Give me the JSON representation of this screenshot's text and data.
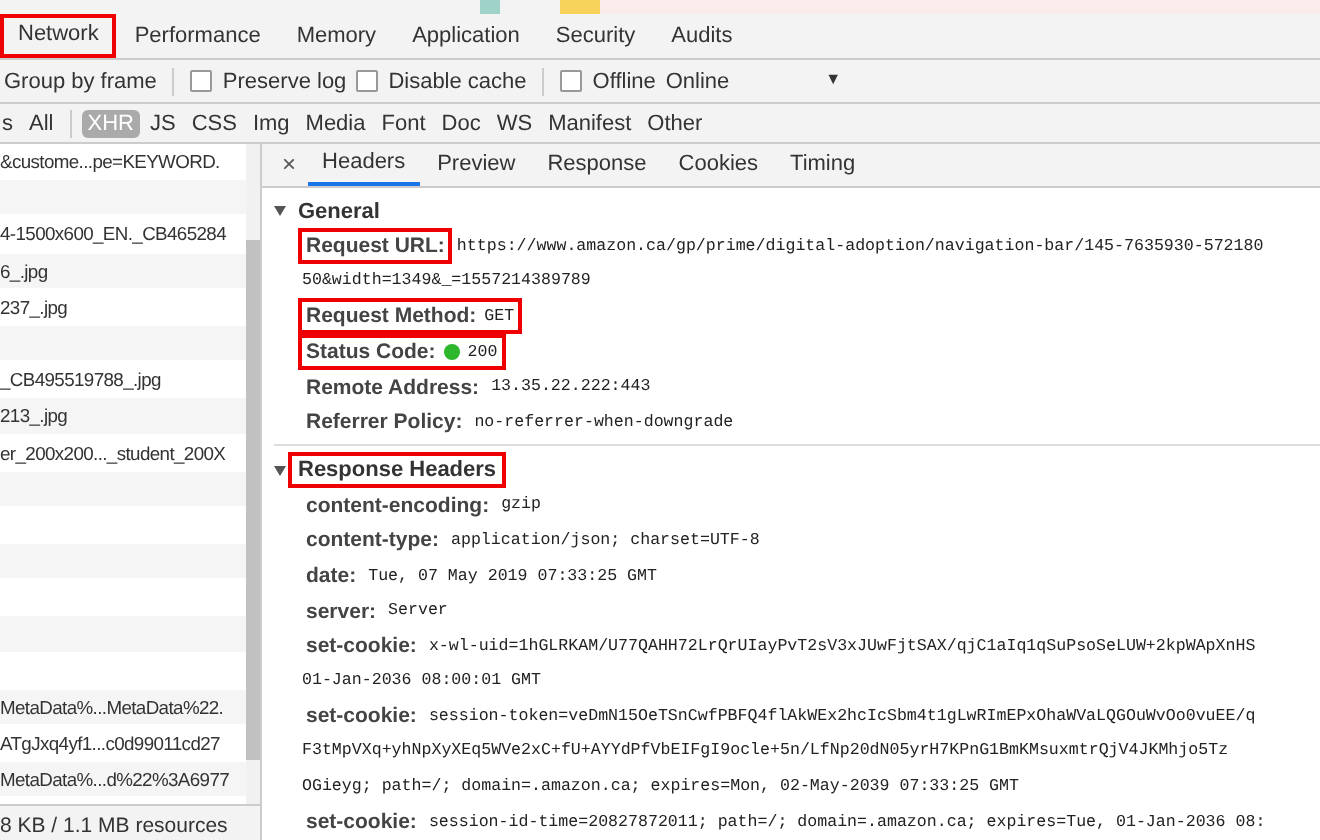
{
  "tabs": [
    {
      "label": "Network",
      "selected": true,
      "highlighted": true
    },
    {
      "label": "Performance",
      "selected": false,
      "highlighted": false
    },
    {
      "label": "Memory",
      "selected": false,
      "highlighted": false
    },
    {
      "label": "Application",
      "selected": false,
      "highlighted": false
    },
    {
      "label": "Security",
      "selected": false,
      "highlighted": false
    },
    {
      "label": "Audits",
      "selected": false,
      "highlighted": false
    }
  ],
  "toolbar": [
    {
      "kind": "text",
      "label": "Group by frame"
    },
    {
      "kind": "checkbox",
      "label": "Preserve log",
      "checked": false
    },
    {
      "kind": "checkbox",
      "label": "Disable cache",
      "checked": false
    },
    {
      "kind": "checkbox",
      "label": "Offline",
      "checked": false
    },
    {
      "kind": "dropdown",
      "label": "Online",
      "caret": "▼"
    }
  ],
  "filters": [
    {
      "label": "s",
      "selected": false
    },
    {
      "label": "All",
      "selected": false
    },
    {
      "label": "XHR",
      "selected": true
    },
    {
      "label": "JS",
      "selected": false
    },
    {
      "label": "CSS",
      "selected": false
    },
    {
      "label": "Img",
      "selected": false
    },
    {
      "label": "Media",
      "selected": false
    },
    {
      "label": "Font",
      "selected": false
    },
    {
      "label": "Doc",
      "selected": false
    },
    {
      "label": "WS",
      "selected": false
    },
    {
      "label": "Manifest",
      "selected": false
    },
    {
      "label": "Other",
      "selected": false
    }
  ],
  "requests": [
    {
      "kind": "request",
      "name": "&custome...pe=KEYWORD."
    },
    {
      "kind": "blank"
    },
    {
      "kind": "request",
      "name": "4-1500x600_EN._CB465284"
    },
    {
      "kind": "request",
      "name": "6_.jpg"
    },
    {
      "kind": "request",
      "name": "237_.jpg"
    },
    {
      "kind": "blank"
    },
    {
      "kind": "request",
      "name": "_CB495519788_.jpg"
    },
    {
      "kind": "request",
      "name": "213_.jpg"
    },
    {
      "kind": "request",
      "name": "er_200x200..._student_200X"
    },
    {
      "kind": "blank"
    },
    {
      "kind": "blank"
    },
    {
      "kind": "blank"
    },
    {
      "kind": "blank"
    },
    {
      "kind": "blank"
    },
    {
      "kind": "blank"
    },
    {
      "kind": "request",
      "name": "MetaData%...MetaData%22."
    },
    {
      "kind": "request",
      "name": "ATgJxq4yf1...c0d99011cd27"
    },
    {
      "kind": "request",
      "name": "MetaData%...d%22%3A6977"
    }
  ],
  "status_bar": "8 KB / 1.1 MB resources",
  "detail_tabs": {
    "close": "×",
    "tabs": [
      {
        "label": "Headers",
        "selected": true
      },
      {
        "label": "Preview",
        "selected": false
      },
      {
        "label": "Response",
        "selected": false
      },
      {
        "label": "Cookies",
        "selected": false
      },
      {
        "label": "Timing",
        "selected": false
      }
    ]
  },
  "sections": [
    {
      "title": "General",
      "expanded": true,
      "highlighted": false,
      "rows": [
        {
          "label": "Request URL:",
          "highlighted": true,
          "lines": [
            "https://www.amazon.ca/gp/prime/digital-adoption/navigation-bar/145-7635930-572180",
            "50&width=1349&_=1557214389789"
          ]
        },
        {
          "label": "Request Method:",
          "highlighted": true,
          "lines": [
            "GET"
          ]
        },
        {
          "label": "Status Code:",
          "highlighted": true,
          "kind": "status",
          "lines": [
            "200"
          ]
        },
        {
          "label": "Remote Address:",
          "highlighted": false,
          "lines": [
            "13.35.22.222:443"
          ]
        },
        {
          "label": "Referrer Policy:",
          "highlighted": false,
          "lines": [
            "no-referrer-when-downgrade"
          ]
        }
      ]
    },
    {
      "title": "Response Headers",
      "expanded": true,
      "highlighted": true,
      "rows": [
        {
          "label": "content-encoding:",
          "highlighted": false,
          "lines": [
            "gzip"
          ]
        },
        {
          "label": "content-type:",
          "highlighted": false,
          "lines": [
            "application/json; charset=UTF-8"
          ]
        },
        {
          "label": "date:",
          "highlighted": false,
          "lines": [
            "Tue, 07 May 2019 07:33:25 GMT"
          ]
        },
        {
          "label": "server:",
          "highlighted": false,
          "lines": [
            "Server"
          ]
        },
        {
          "label": "set-cookie:",
          "highlighted": false,
          "lines": [
            "x-wl-uid=1hGLRKAM/U77QAHH72LrQrUIayPvT2sV3xJUwFjtSAX/qjC1aIq1qSuPsoSeLUW+2kpWApXnHS",
            "01-Jan-2036 08:00:01 GMT"
          ]
        },
        {
          "label": "set-cookie:",
          "highlighted": false,
          "lines": [
            "session-token=veDmN15OeTSnCwfPBFQ4flAkWEx2hcIcSbm4t1gLwRImEPxOhaWVaLQGOuWvOo0vuEE/q",
            "F3tMpVXq+yhNpXyXEq5WVe2xC+fU+AYYdPfVbEIFgI9ocle+5n/LfNp20dN05yrH7KPnG1BmKMsuxmtrQjV4JKMhjo5Tz",
            "OGieyg; path=/; domain=.amazon.ca; expires=Mon, 02-May-2039 07:33:25 GMT"
          ]
        },
        {
          "label": "set-cookie:",
          "highlighted": false,
          "lines": [
            "session-id-time=20827872011; path=/; domain=.amazon.ca; expires=Tue, 01-Jan-2036 08:"
          ]
        }
      ]
    }
  ]
}
